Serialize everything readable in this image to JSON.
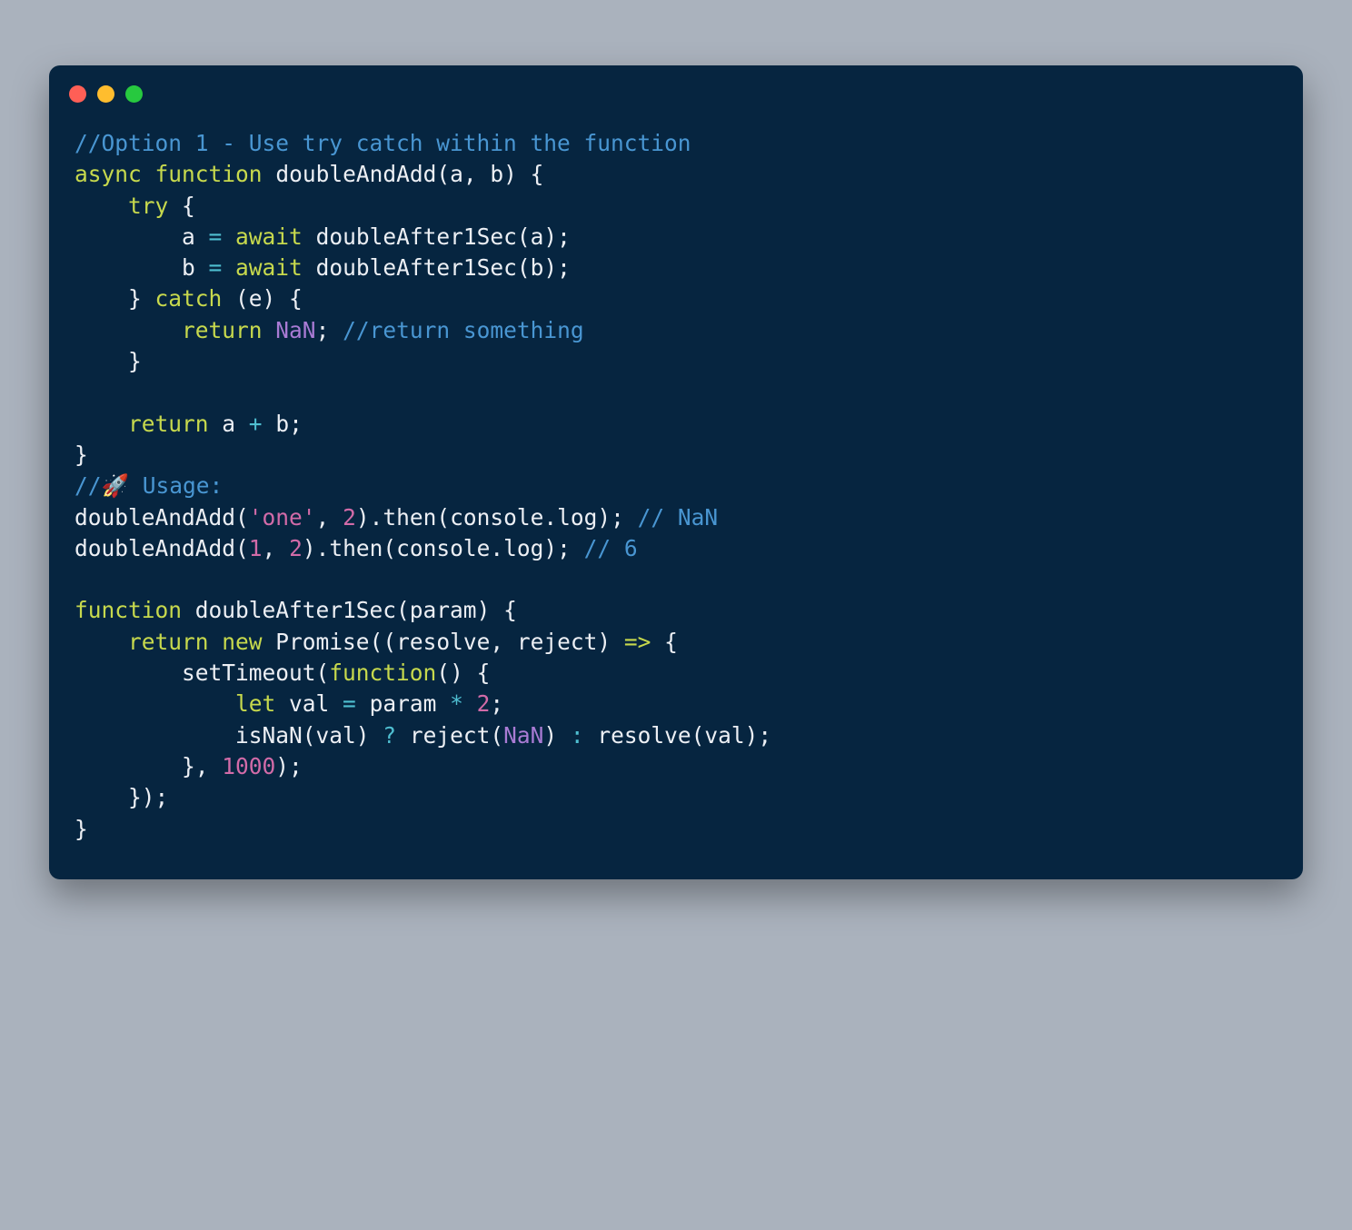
{
  "code": {
    "c01_slashes": "//",
    "c01_rest": "Option 1 - Use try catch within the function",
    "l02_async": "async",
    "l02_function": "function",
    "l02_name": "doubleAndAdd",
    "l02_paren_open": "(",
    "l02_a": "a",
    "l02_comma": ", ",
    "l02_b": "b",
    "l02_paren_close_brace": ") {",
    "l03_indent": "    ",
    "l03_try": "try",
    "l03_brace": " {",
    "l04_indent": "        ",
    "l04_a": "a ",
    "l04_eq": "= ",
    "l04_await": "await",
    "l04_space": " ",
    "l04_call": "doubleAfter1Sec",
    "l04_paren_open": "(",
    "l04_arg": "a",
    "l04_close": ");",
    "l05_b": "b ",
    "l05_arg": "b",
    "l06_indent": "    ",
    "l06_close": "} ",
    "l06_catch": "catch",
    "l06_paren": " (e) {",
    "l07_indent": "        ",
    "l07_return": "return",
    "l07_space": " ",
    "l07_nan": "NaN",
    "l07_semi": "; ",
    "l07_comment_slashes": "//",
    "l07_comment_rest": "return something",
    "l08_indent": "    ",
    "l08_close": "}",
    "l09_blank": "",
    "l10_indent": "    ",
    "l10_return": "return",
    "l10_rest_a": " a ",
    "l10_plus": "+",
    "l10_rest_b": " b;",
    "l11_close": "}",
    "l12_slashes": "//",
    "l12_rocket": "🚀",
    "l12_rest": " Usage:",
    "l13_call": "doubleAndAdd",
    "l13_open": "(",
    "l13_str": "'one'",
    "l13_comma": ", ",
    "l13_two": "2",
    "l13_close_then": ").then(",
    "l13_console": "console",
    "l13_dot_log": ".log); ",
    "l13_cmt_slashes": "// ",
    "l13_cmt_rest": "NaN",
    "l14_one": "1",
    "l14_cmt_rest": "6",
    "l15_blank": "",
    "l16_function": "function",
    "l16_name": " doubleAfter1Sec",
    "l16_open": "(",
    "l16_param": "param",
    "l16_close": ") {",
    "l17_indent": "    ",
    "l17_return": "return",
    "l17_new": " new",
    "l17_promise": " Promise",
    "l17_open": "((",
    "l17_resolve": "resolve",
    "l17_comma": ", ",
    "l17_reject": "reject",
    "l17_arrow_close": ") ",
    "l17_arrow": "=>",
    "l17_brace": " {",
    "l18_indent": "        ",
    "l18_settimeout": "setTimeout",
    "l18_open": "(",
    "l18_function": "function",
    "l18_rest": "() {",
    "l19_indent": "            ",
    "l19_let": "let",
    "l19_val": " val ",
    "l19_eq": "= ",
    "l19_param": "param ",
    "l19_mult": "*",
    "l19_two": " 2",
    "l19_semi": ";",
    "l20_indent": "            ",
    "l20_isnan": "isNaN",
    "l20_open": "(val) ",
    "l20_q": "?",
    "l20_reject": " reject(",
    "l20_nan": "NaN",
    "l20_close1": ") ",
    "l20_colon": ":",
    "l20_resolve": " resolve(val);",
    "l21_indent": "        ",
    "l21_close": "}, ",
    "l21_thousand": "1000",
    "l21_close2": ");",
    "l22_indent": "    ",
    "l22_close": "});",
    "l23_close": "}"
  }
}
